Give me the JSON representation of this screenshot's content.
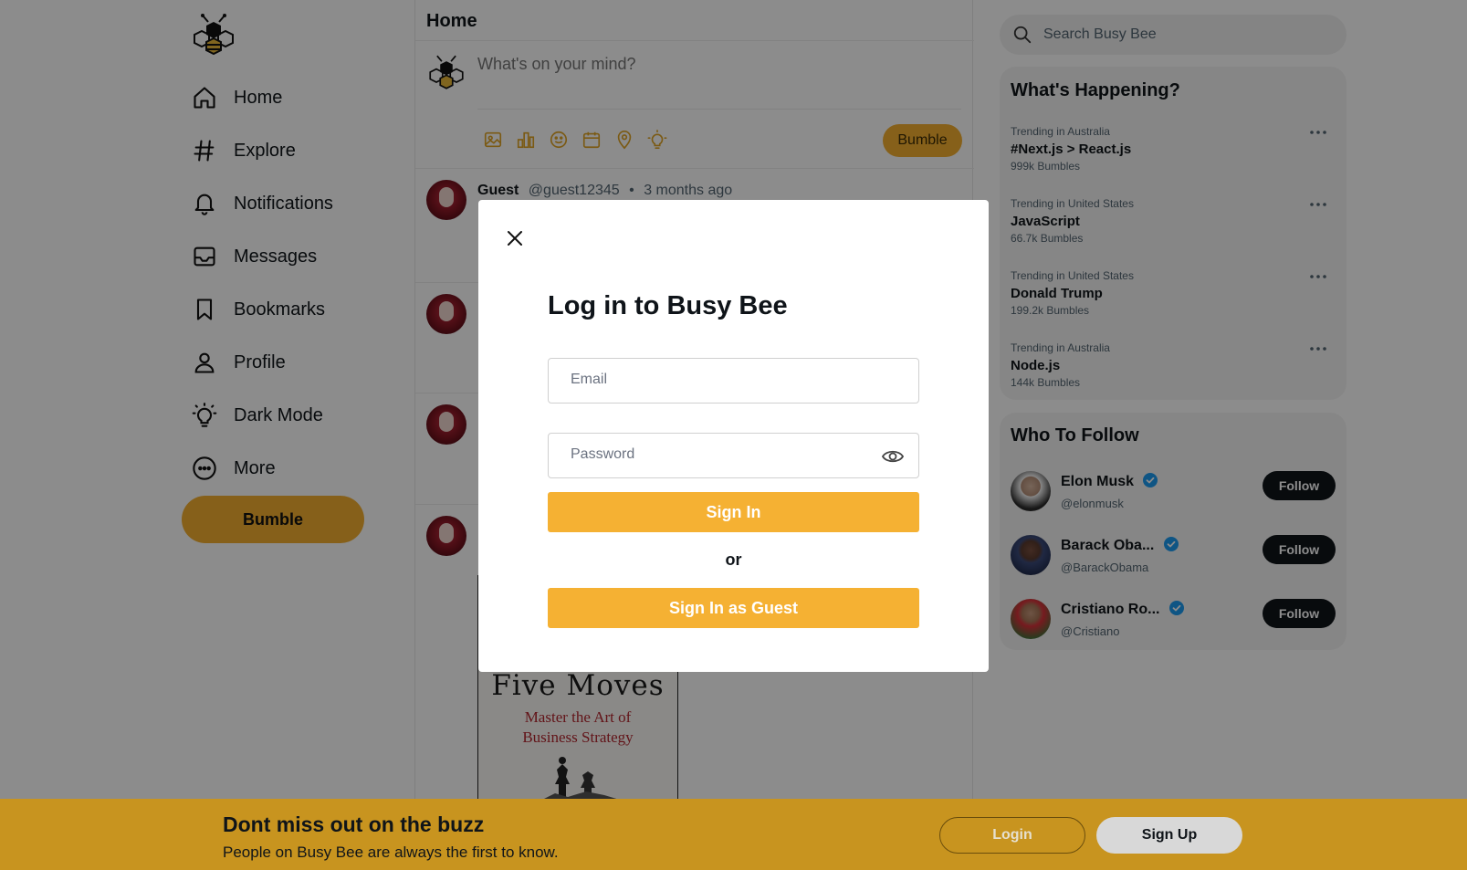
{
  "app": {
    "name": "Busy Bee"
  },
  "sidebar": {
    "logo_icon": "bee-logo-icon",
    "nav": [
      {
        "label": "Home",
        "icon": "home-icon"
      },
      {
        "label": "Explore",
        "icon": "hashtag-icon"
      },
      {
        "label": "Notifications",
        "icon": "bell-icon"
      },
      {
        "label": "Messages",
        "icon": "inbox-icon"
      },
      {
        "label": "Bookmarks",
        "icon": "bookmark-icon"
      },
      {
        "label": "Profile",
        "icon": "user-icon"
      },
      {
        "label": "Dark Mode",
        "icon": "lightbulb-icon"
      },
      {
        "label": "More",
        "icon": "more-circle-icon"
      }
    ],
    "bumble_label": "Bumble"
  },
  "feed": {
    "title": "Home",
    "composer": {
      "placeholder": "What's on your mind?",
      "tools": [
        "image-icon",
        "poll-icon",
        "emoji-icon",
        "calendar-icon",
        "location-icon",
        "idea-icon"
      ],
      "submit_label": "Bumble"
    },
    "post": {
      "name": "Guest",
      "handle": "@guest12345",
      "separator": "•",
      "time": "3 months ago"
    },
    "book": {
      "title": "Five Moves",
      "subtitle_line1": "Master the Art of",
      "subtitle_line2": "Business Strategy"
    }
  },
  "right": {
    "search": {
      "placeholder": "Search Busy Bee"
    },
    "trending": {
      "title": "What's Happening?",
      "items": [
        {
          "location": "Trending in Australia",
          "topic": "#Next.js > React.js",
          "count": "999k Bumbles"
        },
        {
          "location": "Trending in United States",
          "topic": "JavaScript",
          "count": "66.7k Bumbles"
        },
        {
          "location": "Trending in United States",
          "topic": "Donald Trump",
          "count": "199.2k Bumbles"
        },
        {
          "location": "Trending in Australia",
          "topic": "Node.js",
          "count": "144k Bumbles"
        }
      ]
    },
    "who_to_follow": {
      "title": "Who To Follow",
      "button_label": "Follow",
      "users": [
        {
          "name": "Elon Musk",
          "handle": "@elonmusk",
          "verified": true
        },
        {
          "name": "Barack Oba...",
          "handle": "@BarackObama",
          "verified": true
        },
        {
          "name": "Cristiano Ro...",
          "handle": "@Cristiano",
          "verified": true
        }
      ]
    }
  },
  "modal": {
    "title": "Log in to Busy Bee",
    "email_placeholder": "Email",
    "password_placeholder": "Password",
    "sign_in_label": "Sign In",
    "or_label": "or",
    "guest_label": "Sign In as Guest"
  },
  "banner": {
    "headline": "Dont miss out on the buzz",
    "subtext": "People on Busy Bee are always the first to know.",
    "login_label": "Login",
    "signup_label": "Sign Up"
  },
  "colors": {
    "accent": "#f4b030",
    "banner": "#c8941f",
    "verified": "#1d9bf0",
    "follow_button": "#0f1419"
  }
}
